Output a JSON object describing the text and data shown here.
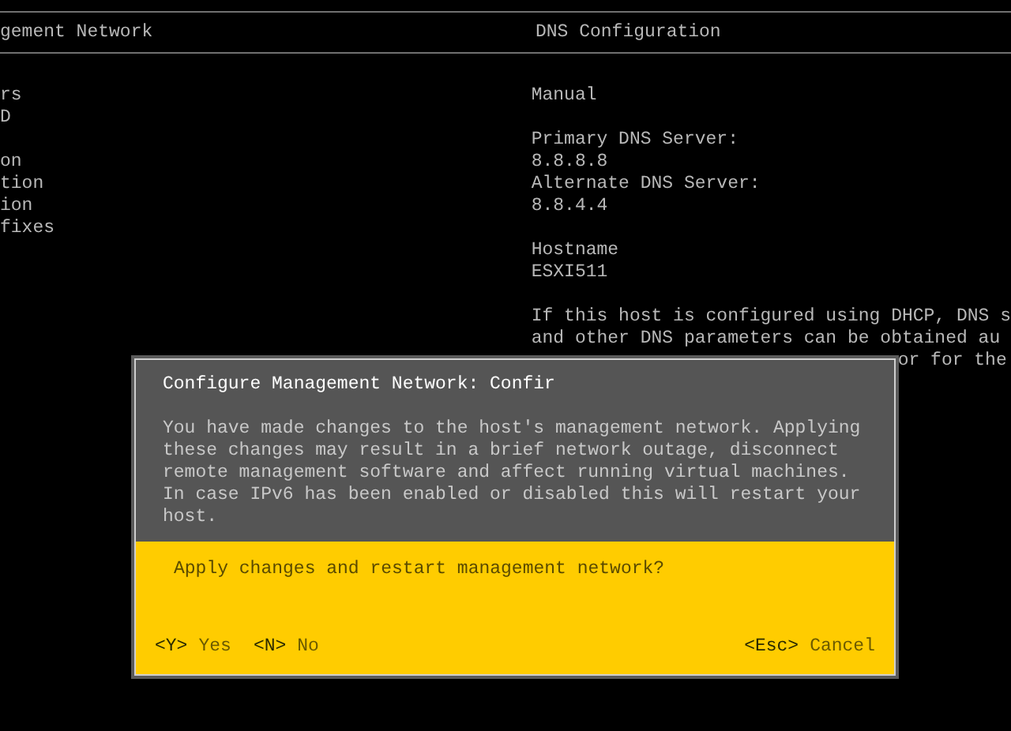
{
  "left_panel": {
    "title": "gement Network",
    "groups": [
      [
        "rs",
        "D"
      ],
      [
        "on",
        "tion",
        "ion",
        "fixes"
      ]
    ]
  },
  "right_panel": {
    "title": "DNS Configuration",
    "groups": [
      [
        "Manual"
      ],
      [
        "Primary DNS Server:",
        "8.8.8.8",
        "Alternate DNS Server:",
        "8.8.4.4"
      ],
      [
        "Hostname",
        "ESXI511"
      ],
      [
        "If this host is configured using DHCP, DNS s",
        "and other DNS parameters can be obtained au"
      ]
    ],
    "hidden_line": "or for the"
  },
  "dialog": {
    "title": "Configure Management Network: Confir",
    "message": "You have made changes to the host's management network. Applying these changes may result in a brief network outage, disconnect remote management software and affect running virtual machines. In case IPv6 has been enabled or disabled this will restart your host.",
    "question": "Apply changes and restart management network?",
    "left_actions": [
      {
        "key": "<Y>",
        "label": "Yes"
      },
      {
        "key": "<N>",
        "label": "No"
      }
    ],
    "right_actions": [
      {
        "key": "<Esc>",
        "label": "Cancel"
      }
    ]
  }
}
